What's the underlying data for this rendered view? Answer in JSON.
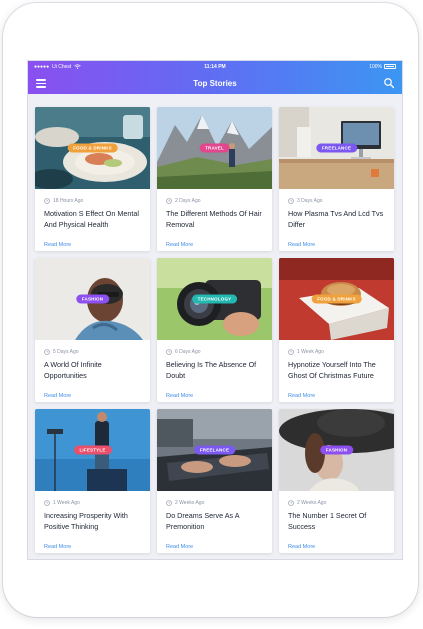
{
  "status": {
    "carrier": "Ui Chest",
    "time": "11:14 PM",
    "battery": "100%"
  },
  "header": {
    "title": "Top Stories",
    "menu_icon": "hamburger-icon",
    "search_icon": "search-icon"
  },
  "colors": {
    "gradient_start": "#8a4ff0",
    "gradient_end": "#3c96f2",
    "link": "#3f8de8"
  },
  "cards": [
    {
      "category": "FOOD & DRINKS",
      "badge_color": "#f0a13b",
      "time": "18 Hours Ago",
      "title": "Motivation S Effect On Mental And Physical Health",
      "link": "Read More"
    },
    {
      "category": "TRAVEL",
      "badge_color": "#e3468c",
      "time": "2 Days Ago",
      "title": "The Different Methods Of Hair Removal",
      "link": "Read More"
    },
    {
      "category": "FREELANCE",
      "badge_color": "#7b59f0",
      "time": "3 Days Ago",
      "title": "How Plasma Tvs And Lcd Tvs Differ",
      "link": "Read More"
    },
    {
      "category": "FASHION",
      "badge_color": "#8d4ff0",
      "time": "5 Days Ago",
      "title": "A World Of Infinite Opportunities",
      "link": "Read More"
    },
    {
      "category": "TECHNOLOGY",
      "badge_color": "#23b8b0",
      "time": "6 Days Ago",
      "title": "Believing Is The Absence Of Doubt",
      "link": "Read More"
    },
    {
      "category": "FOOD & DRINKS",
      "badge_color": "#f0a13b",
      "time": "1 Week Ago",
      "title": "Hypnotize Yourself Into The Ghost Of Christmas Future",
      "link": "Read More"
    },
    {
      "category": "LIFESTYLE",
      "badge_color": "#ea4f6c",
      "time": "1 Week Ago",
      "title": "Increasing Prosperity With Positive Thinking",
      "link": "Read More"
    },
    {
      "category": "FREELANCE",
      "badge_color": "#7b59f0",
      "time": "2 Weeks Ago",
      "title": "Do Dreams Serve As A Premonition",
      "link": "Read More"
    },
    {
      "category": "FASHION",
      "badge_color": "#8d4ff0",
      "time": "2 Weeks Ago",
      "title": "The Number 1 Secret Of Success",
      "link": "Read More"
    }
  ]
}
